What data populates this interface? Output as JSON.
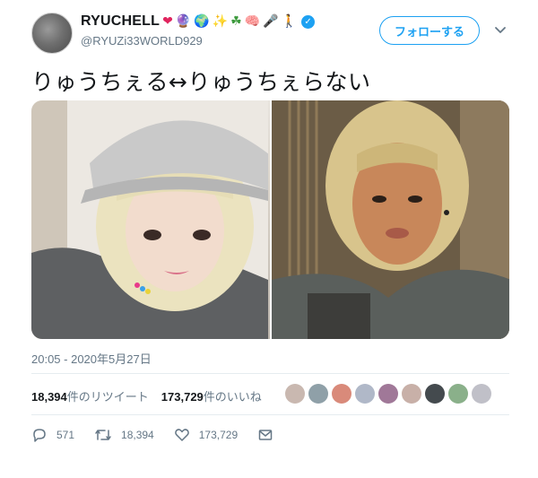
{
  "user": {
    "display_name": "RYUCHELL",
    "emojis": [
      "❤",
      "🔮",
      "🌍",
      "✨",
      "☘",
      "🧠",
      "🎤",
      "🚶"
    ],
    "handle": "@RYUZi33WORLD929",
    "verified_mark": "✓"
  },
  "follow_button": {
    "label": "フォローする"
  },
  "tweet": {
    "text": "りゅうちぇる↔りゅうちぇらない",
    "timestamp": "20:05 - 2020年5月27日"
  },
  "stats": {
    "retweets_count": "18,394",
    "retweets_label": "件のリツイート",
    "likes_count": "173,729",
    "likes_label": "件のいいね"
  },
  "actions": {
    "replies": "571",
    "retweets": "18,394",
    "likes": "173,729"
  },
  "colors": {
    "accent": "#1da1f2",
    "muted": "#657786",
    "text": "#14171a",
    "heart": "#e0245e"
  },
  "icons": {
    "reply": "reply-icon",
    "retweet": "retweet-icon",
    "like": "heart-icon",
    "message": "envelope-icon",
    "more": "chevron-down-icon"
  }
}
